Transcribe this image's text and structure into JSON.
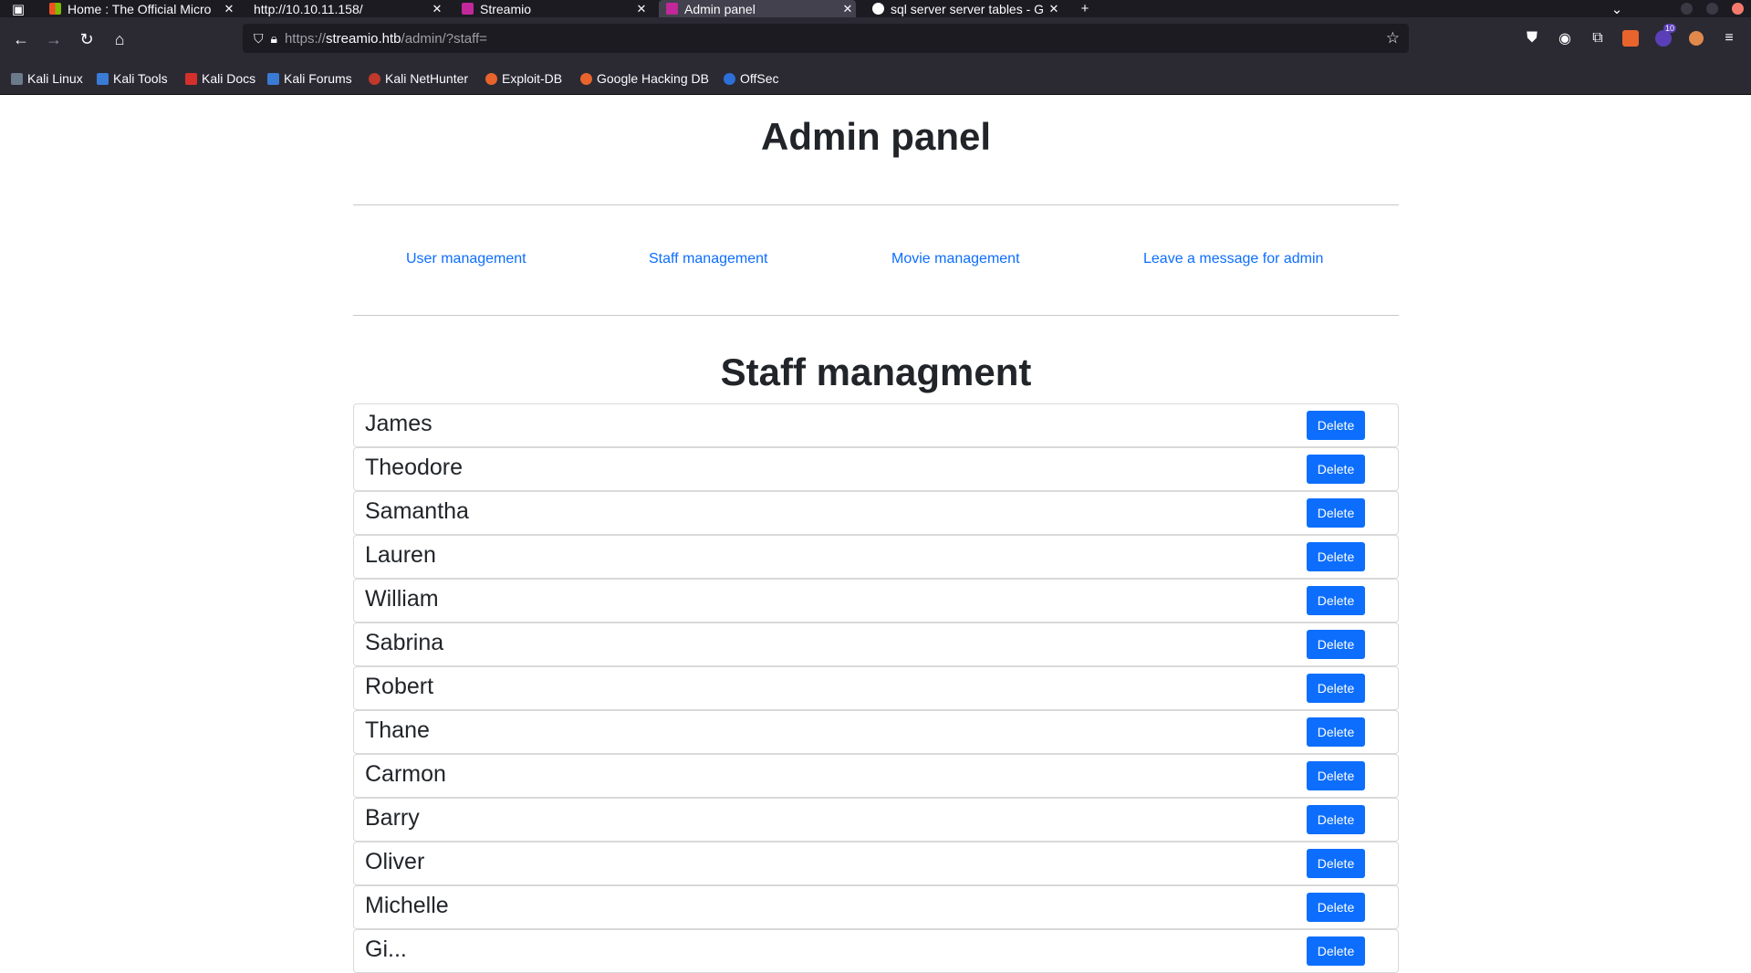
{
  "browser": {
    "tabs": [
      {
        "title": "Home : The Official Micro",
        "active": false
      },
      {
        "title": "http://10.10.11.158/",
        "active": false
      },
      {
        "title": "Streamio",
        "active": false
      },
      {
        "title": "Admin panel",
        "active": true
      },
      {
        "title": "sql server server tables - G",
        "active": false
      }
    ],
    "new_tab_symbol": "+",
    "url_prefix": "https://",
    "url_host": "streamio.htb",
    "url_path": "/admin/?staff=",
    "extension_badge": "10",
    "bookmarks": [
      {
        "label": "Kali Linux"
      },
      {
        "label": "Kali Tools"
      },
      {
        "label": "Kali Docs"
      },
      {
        "label": "Kali Forums"
      },
      {
        "label": "Kali NetHunter"
      },
      {
        "label": "Exploit-DB"
      },
      {
        "label": "Google Hacking DB"
      },
      {
        "label": "OffSec"
      }
    ]
  },
  "page": {
    "title": "Admin panel",
    "nav": [
      {
        "label": "User management"
      },
      {
        "label": "Staff management"
      },
      {
        "label": "Movie management"
      },
      {
        "label": "Leave a message for admin"
      }
    ],
    "section_title": "Staff managment",
    "delete_label": "Delete",
    "staff": [
      {
        "name": "James"
      },
      {
        "name": "Theodore"
      },
      {
        "name": "Samantha"
      },
      {
        "name": "Lauren"
      },
      {
        "name": "William"
      },
      {
        "name": "Sabrina"
      },
      {
        "name": "Robert"
      },
      {
        "name": "Thane"
      },
      {
        "name": "Carmon"
      },
      {
        "name": "Barry"
      },
      {
        "name": "Oliver"
      },
      {
        "name": "Michelle"
      },
      {
        "name": "Gi..."
      }
    ]
  },
  "colors": {
    "link": "#0d6efd",
    "button": "#0d6efd",
    "chrome_dark": "#1c1b22",
    "chrome": "#2b2a33"
  }
}
